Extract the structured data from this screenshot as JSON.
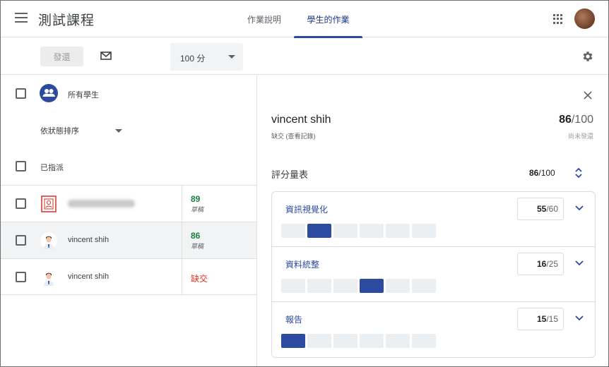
{
  "header": {
    "course_title": "測試課程",
    "tabs": [
      "作業說明",
      "學生的作業"
    ]
  },
  "toolbar": {
    "return_label": "發還",
    "points_value": "100 分"
  },
  "left_panel": {
    "all_students_label": "所有學生",
    "sort_label": "依狀態排序",
    "assigned_label": "已指派",
    "students": [
      {
        "name": "",
        "grade": "89",
        "status": "草稿",
        "avatar": "profile-placeholder-icon",
        "selected": false
      },
      {
        "name": "vincent shih",
        "grade": "86",
        "status": "草稿",
        "avatar": "person-avatar",
        "selected": true
      },
      {
        "name": "vincent shih",
        "grade": "缺交",
        "status": "",
        "avatar": "person-avatar",
        "selected": false
      }
    ]
  },
  "detail": {
    "student_name": "vincent shih",
    "student_sub": "缺交 (查看記錄)",
    "score": "86",
    "score_max": "/100",
    "send_status": "尚未發還",
    "rubric_title": "評分量表",
    "rubric_score": "86",
    "rubric_max": "/100",
    "criteria": [
      {
        "name": "資訊視覺化",
        "score": "55",
        "max": "/60",
        "levels": 6,
        "selected_level": 2
      },
      {
        "name": "資料統整",
        "score": "16",
        "max": "/25",
        "levels": 6,
        "selected_level": 4
      },
      {
        "name": "報告",
        "score": "15",
        "max": "/15",
        "levels": 6,
        "selected_level": 1
      }
    ]
  },
  "colors": {
    "accent": "#2b4aa0",
    "grade_green": "#188038",
    "missing_red": "#d93025"
  }
}
